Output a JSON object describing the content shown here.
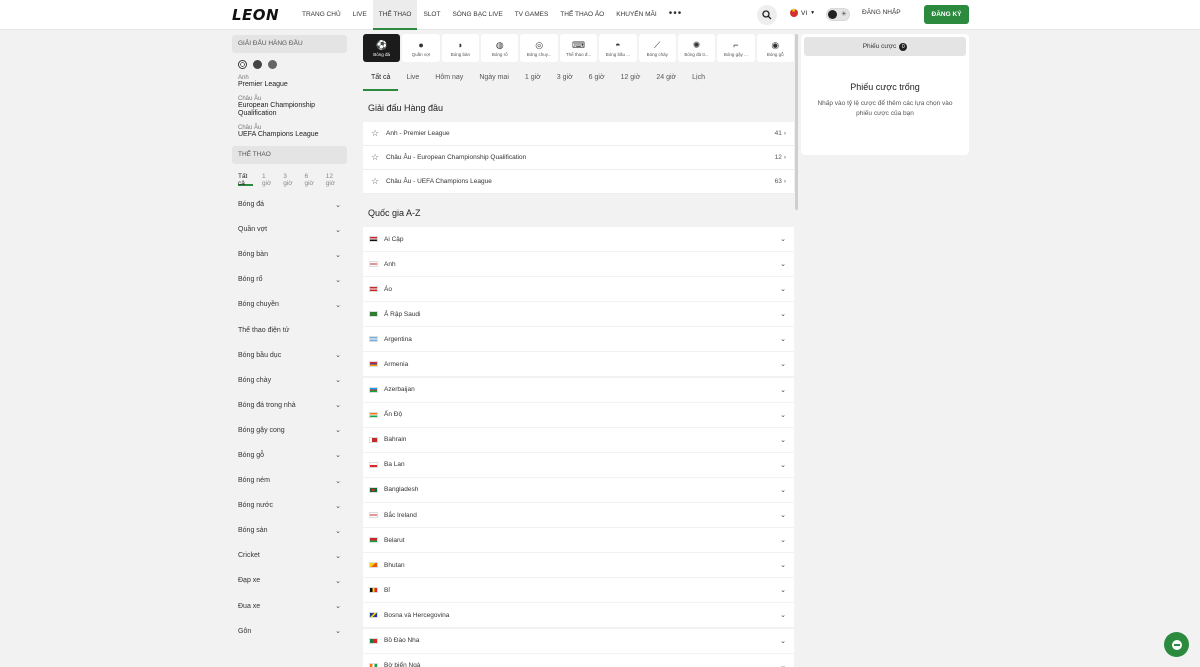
{
  "header": {
    "logo": "LEON",
    "nav": [
      "TRANG CHỦ",
      "LIVE",
      "THỂ THAO",
      "SLOT",
      "SÒNG BẠC LIVE",
      "TV GAMES",
      "THỂ THAO ẢO",
      "KHUYẾN MÃI"
    ],
    "nav_active": "THỂ THAO",
    "more": "•••",
    "lang": "VI",
    "login": "ĐĂNG NHẬP",
    "register": "ĐĂNG KÝ"
  },
  "sidebar": {
    "top_header": "GIẢI ĐẤU HÀNG ĐẦU",
    "top_leagues": [
      {
        "region": "Anh",
        "name": "Premier League"
      },
      {
        "region": "Châu Âu",
        "name": "European Championship Qualification"
      },
      {
        "region": "Châu Âu",
        "name": "UEFA Champions League"
      }
    ],
    "sports_header": "THỂ THAO",
    "time_tabs": [
      "Tất cả",
      "1 giờ",
      "3 giờ",
      "6 giờ",
      "12 giờ"
    ],
    "sports": [
      {
        "name": "Bóng đá",
        "chevron": true
      },
      {
        "name": "Quần vợt",
        "chevron": true
      },
      {
        "name": "Bóng bàn",
        "chevron": true
      },
      {
        "name": "Bóng rổ",
        "chevron": true
      },
      {
        "name": "Bóng chuyền",
        "chevron": true
      },
      {
        "name": "Thể thao điện tử",
        "chevron": false
      },
      {
        "name": "Bóng bầu dục",
        "chevron": true
      },
      {
        "name": "Bóng chày",
        "chevron": true
      },
      {
        "name": "Bóng đá trong nhà",
        "chevron": true
      },
      {
        "name": "Bóng gậy cong",
        "chevron": true
      },
      {
        "name": "Bóng gỗ",
        "chevron": true
      },
      {
        "name": "Bóng ném",
        "chevron": true
      },
      {
        "name": "Bóng nước",
        "chevron": true
      },
      {
        "name": "Bóng sàn",
        "chevron": true
      },
      {
        "name": "Cricket",
        "chevron": true
      },
      {
        "name": "Đạp xe",
        "chevron": true
      },
      {
        "name": "Đua xe",
        "chevron": true
      },
      {
        "name": "Gôn",
        "chevron": true
      }
    ]
  },
  "main": {
    "sport_tabs": [
      {
        "label": "Bóng đá",
        "icon": "⚽"
      },
      {
        "label": "Quần vợt",
        "icon": "●"
      },
      {
        "label": "Bóng bàn",
        "icon": "◗"
      },
      {
        "label": "Bóng rổ",
        "icon": "◍"
      },
      {
        "label": "Bóng chuy...",
        "icon": "◎"
      },
      {
        "label": "Thể thao đ...",
        "icon": "⌨"
      },
      {
        "label": "Bóng bầu ...",
        "icon": "◓"
      },
      {
        "label": "Bóng chày",
        "icon": "⟋"
      },
      {
        "label": "Bóng đá tr...",
        "icon": "✺"
      },
      {
        "label": "Bóng gậy ...",
        "icon": "⌐"
      },
      {
        "label": "Bóng gỗ",
        "icon": "◉"
      }
    ],
    "filter_tabs": [
      "Tất cả",
      "Live",
      "Hôm nay",
      "Ngày mai",
      "1 giờ",
      "3 giờ",
      "6 giờ",
      "12 giờ",
      "24 giờ",
      "Lịch"
    ],
    "top_title": "Giải đấu Hàng đầu",
    "top_leagues": [
      {
        "name": "Anh - Premier League",
        "count": "41"
      },
      {
        "name": "Châu Âu - European Championship Qualification",
        "count": "12"
      },
      {
        "name": "Châu Âu - UEFA Champions League",
        "count": "63"
      }
    ],
    "countries_title": "Quốc gia A-Z",
    "countries": [
      "Ai Cập",
      "Anh",
      "Áo",
      "Ả Rập Saudi",
      "Argentina",
      "Armenia",
      "Azerbaijan",
      "Ấn Độ",
      "Bahrain",
      "Ba Lan",
      "Bangladesh",
      "Bắc Ireland",
      "Belarut",
      "Bhutan",
      "Bỉ",
      "Bosna và Hercegovina",
      "Bồ Đào Nha",
      "Bờ biển Ngà"
    ]
  },
  "betslip": {
    "tab": "Phiếu cược",
    "count": "0",
    "title": "Phiếu cược trống",
    "desc": "Nhấp vào tỷ lệ cược để thêm các lựa chọn vào phiếu cược của bạn"
  },
  "colors": {
    "accent": "#2b8a3e",
    "bg": "#f2f2f2"
  }
}
